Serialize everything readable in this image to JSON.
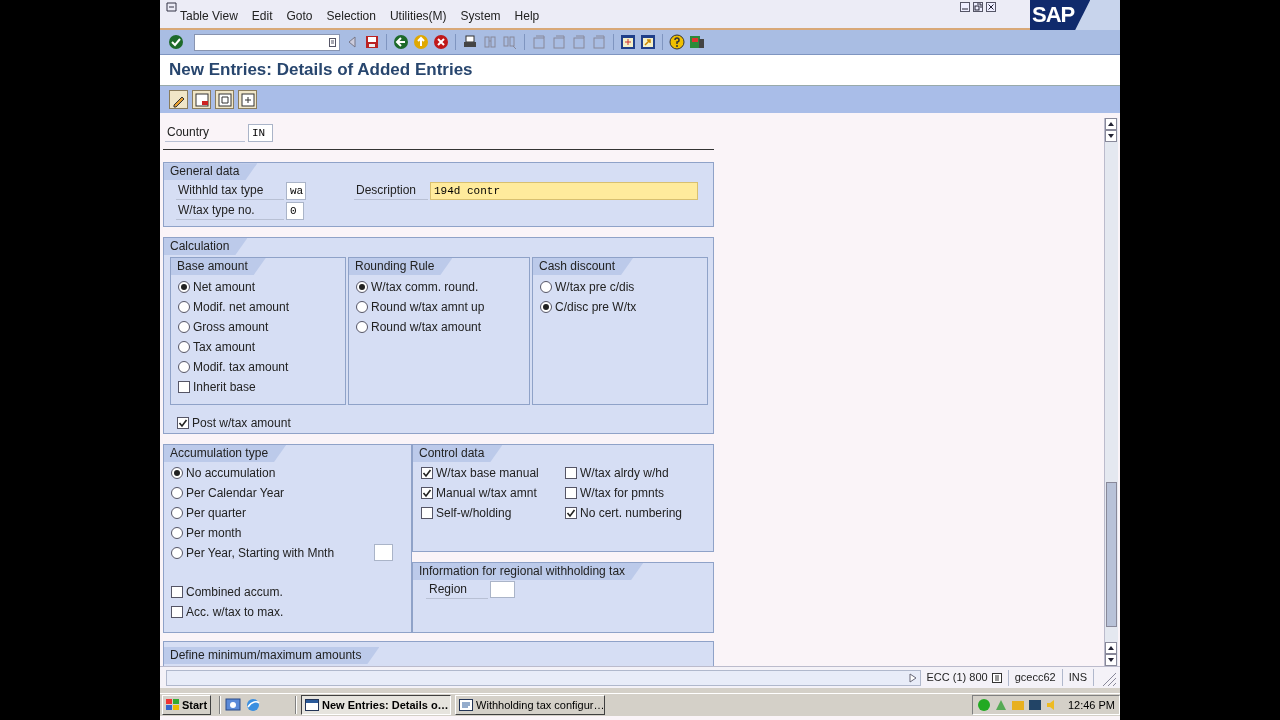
{
  "window": {
    "menu": [
      "Table View",
      "Edit",
      "Goto",
      "Selection",
      "Utilities(M)",
      "System",
      "Help"
    ],
    "logo": "SAP",
    "title": "New Entries: Details of Added Entries"
  },
  "country": {
    "label": "Country",
    "value": "IN"
  },
  "general_data": {
    "title": "General data",
    "fields": [
      {
        "label": "Withhld tax type",
        "value": "wa",
        "focused": false
      },
      {
        "label": "W/tax type no.",
        "value": "0",
        "focused": false
      },
      {
        "label": "Description",
        "value": "194d contr",
        "focused": true
      }
    ]
  },
  "calculation": {
    "title": "Calculation",
    "groups": [
      {
        "title": "Base amount",
        "options": [
          {
            "kind": "radio",
            "label": "Net amount",
            "selected": true
          },
          {
            "kind": "radio",
            "label": "Modif. net amount",
            "selected": false
          },
          {
            "kind": "radio",
            "label": "Gross amount",
            "selected": false
          },
          {
            "kind": "radio",
            "label": "Tax amount",
            "selected": false
          },
          {
            "kind": "radio",
            "label": "Modif. tax amount",
            "selected": false
          },
          {
            "kind": "checkbox",
            "label": "Inherit base",
            "checked": false
          }
        ]
      },
      {
        "title": "Rounding Rule",
        "options": [
          {
            "kind": "radio",
            "label": "W/tax comm. round.",
            "selected": true
          },
          {
            "kind": "radio",
            "label": "Round w/tax amnt up",
            "selected": false
          },
          {
            "kind": "radio",
            "label": "Round w/tax amount",
            "selected": false
          }
        ]
      },
      {
        "title": "Cash discount",
        "options": [
          {
            "kind": "radio",
            "label": "W/tax pre c/dis",
            "selected": false
          },
          {
            "kind": "radio",
            "label": "C/disc pre W/tx",
            "selected": true
          }
        ]
      }
    ],
    "post": {
      "label": "Post w/tax amount",
      "checked": true
    }
  },
  "accumulation": {
    "title": "Accumulation type",
    "options": [
      {
        "kind": "radio",
        "label": "No accumulation",
        "selected": true
      },
      {
        "kind": "radio",
        "label": "Per Calendar Year",
        "selected": false
      },
      {
        "kind": "radio",
        "label": "Per quarter",
        "selected": false
      },
      {
        "kind": "radio",
        "label": "Per month",
        "selected": false
      },
      {
        "kind": "radio_field",
        "label": "Per Year, Starting with Mnth",
        "selected": false
      }
    ],
    "checks": [
      {
        "label": "Combined accum.",
        "checked": false
      },
      {
        "label": "Acc. w/tax to max.",
        "checked": false
      }
    ]
  },
  "control_data": {
    "title": "Control data",
    "options": [
      {
        "label": "W/tax base manual",
        "checked": true
      },
      {
        "label": "W/tax alrdy w/hd",
        "checked": false
      },
      {
        "label": "Manual w/tax amnt",
        "checked": true
      },
      {
        "label": "W/tax for pmnts",
        "checked": false
      },
      {
        "label": "Self-w/holding",
        "checked": false
      },
      {
        "label": "No cert. numbering",
        "checked": true
      }
    ]
  },
  "regional": {
    "title": "Information for regional withholding tax",
    "field_label": "Region"
  },
  "next_section": {
    "title": "Define minimum/maximum amounts"
  },
  "status_bar": {
    "system": "ECC (1) 800",
    "user": "gcecc62",
    "mode": "INS"
  },
  "taskbar": {
    "start": "Start",
    "tasks": [
      {
        "label": "New Entries: Details o…",
        "selected": true
      },
      {
        "label": "Withholding tax configur…",
        "selected": false
      }
    ],
    "clock": "12:46 PM"
  }
}
